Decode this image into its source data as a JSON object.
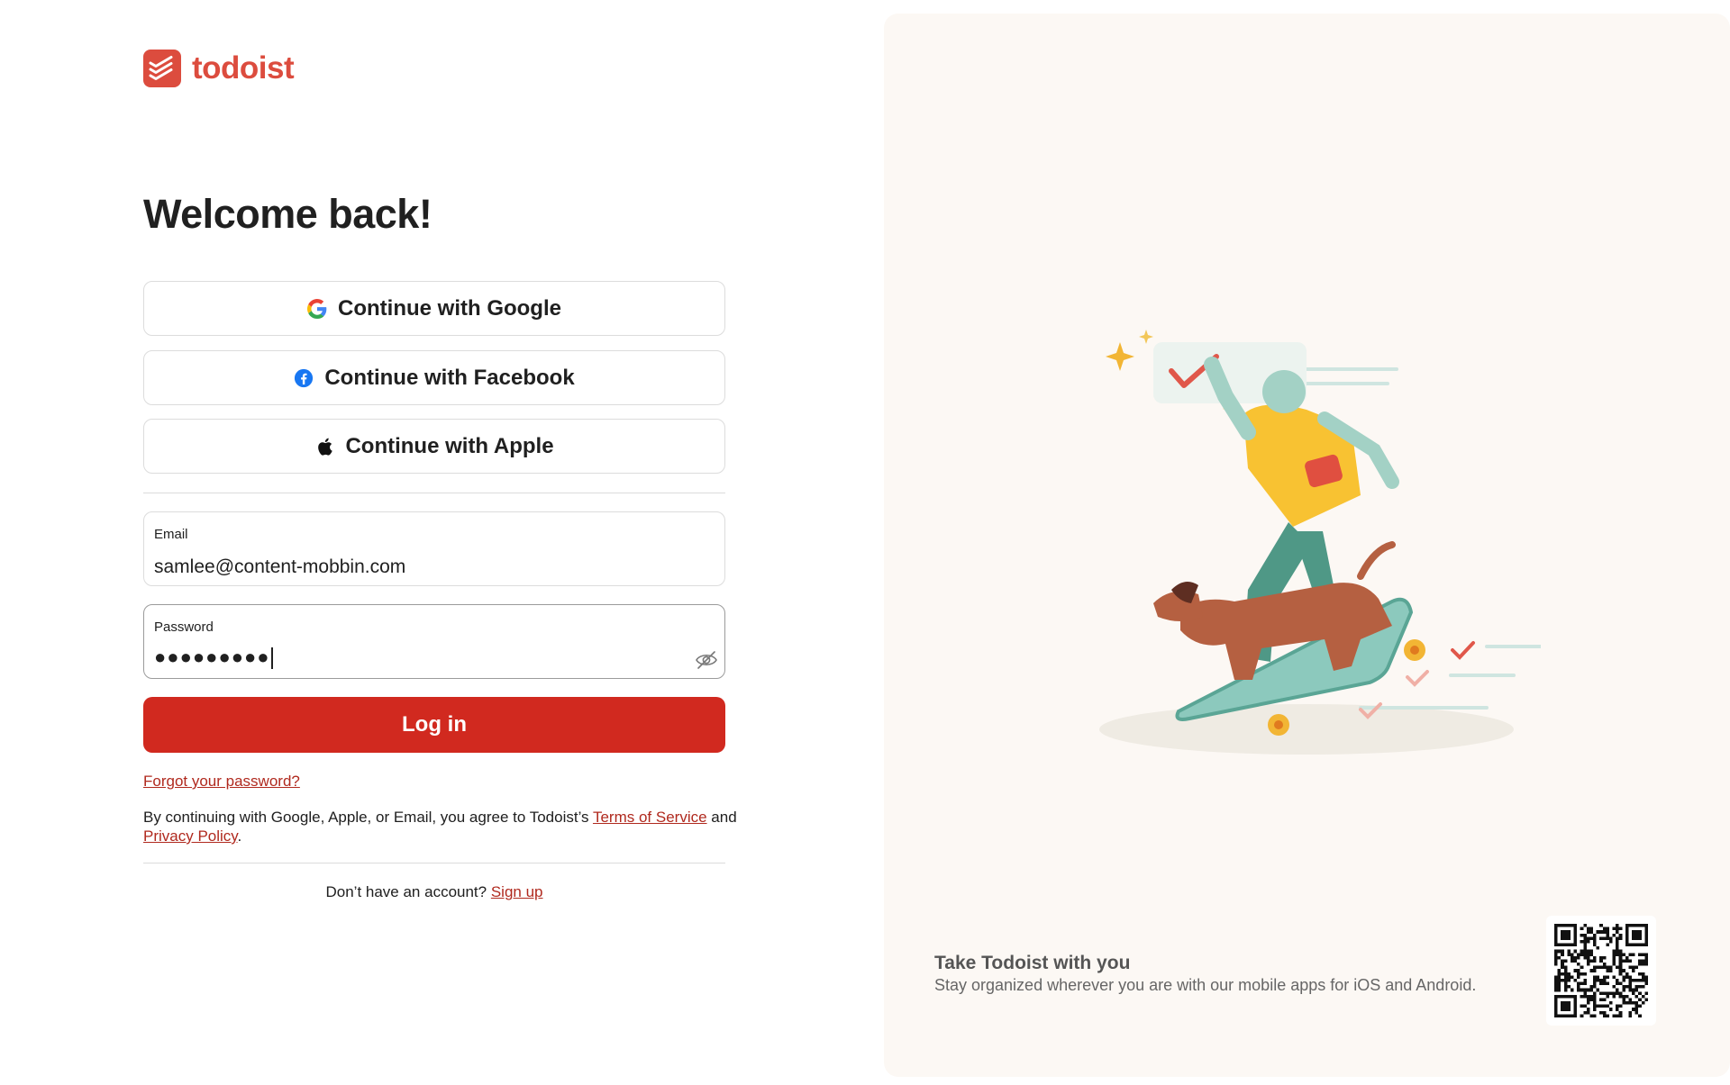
{
  "brand": {
    "name": "todoist",
    "color": "#dc4c3e"
  },
  "heading": "Welcome back!",
  "sso": {
    "google": {
      "label": "Continue with Google",
      "icon": "google-icon"
    },
    "facebook": {
      "label": "Continue with Facebook",
      "icon": "facebook-icon"
    },
    "apple": {
      "label": "Continue with Apple",
      "icon": "apple-icon"
    }
  },
  "email": {
    "label": "Email",
    "value": "samlee@content-mobbin.com"
  },
  "password": {
    "label": "Password",
    "value": "●●●●●●●●●",
    "toggle_icon": "eye-slash-icon"
  },
  "login_button": {
    "label": "Log in",
    "color": "#d1291f"
  },
  "forgot_link": "Forgot your password?",
  "legal": {
    "prefix": "By continuing with Google, Apple, or Email, you agree to Todoist’s ",
    "terms": "Terms of Service",
    "middle": " and ",
    "privacy": "Privacy Policy",
    "suffix": "."
  },
  "signup": {
    "prompt": "Don’t have an account? ",
    "link": "Sign up"
  },
  "promo": {
    "title": "Take Todoist with you",
    "subtitle": "Stay organized wherever you are with our mobile apps for iOS and Android.",
    "qr_icon": "qr-code"
  },
  "colors": {
    "panel": "#fcf8f4",
    "link": "#b0291e"
  }
}
